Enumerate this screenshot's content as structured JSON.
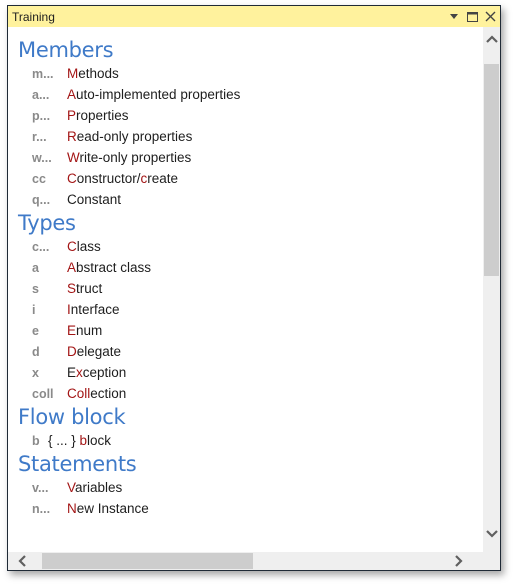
{
  "window": {
    "title": "Training",
    "controls": {
      "dropdown": "dropdown-icon",
      "maximize": "maximize-icon",
      "close": "close-icon"
    }
  },
  "sections": [
    {
      "heading": "Members",
      "items": [
        {
          "abbr": "m...",
          "parts": [
            {
              "t": "M",
              "h": true
            },
            {
              "t": "ethods",
              "h": false
            }
          ]
        },
        {
          "abbr": "a...",
          "parts": [
            {
              "t": "A",
              "h": true
            },
            {
              "t": "uto-implemented properties",
              "h": false
            }
          ]
        },
        {
          "abbr": "p...",
          "parts": [
            {
              "t": "P",
              "h": true
            },
            {
              "t": "roperties",
              "h": false
            }
          ]
        },
        {
          "abbr": "r...",
          "parts": [
            {
              "t": "R",
              "h": true
            },
            {
              "t": "ead-only properties",
              "h": false
            }
          ]
        },
        {
          "abbr": "w...",
          "parts": [
            {
              "t": "W",
              "h": true
            },
            {
              "t": "rite-only properties",
              "h": false
            }
          ]
        },
        {
          "abbr": "cc",
          "parts": [
            {
              "t": "C",
              "h": true
            },
            {
              "t": "onstructor/",
              "h": false
            },
            {
              "t": "c",
              "h": true
            },
            {
              "t": "reate",
              "h": false
            }
          ]
        },
        {
          "abbr": "q...",
          "parts": [
            {
              "t": "Constant",
              "h": false
            }
          ]
        }
      ]
    },
    {
      "heading": "Types",
      "items": [
        {
          "abbr": "c...",
          "parts": [
            {
              "t": "C",
              "h": true
            },
            {
              "t": "lass",
              "h": false
            }
          ]
        },
        {
          "abbr": "a",
          "parts": [
            {
              "t": "A",
              "h": true
            },
            {
              "t": "bstract class",
              "h": false
            }
          ]
        },
        {
          "abbr": "s",
          "parts": [
            {
              "t": "S",
              "h": true
            },
            {
              "t": "truct",
              "h": false
            }
          ]
        },
        {
          "abbr": "i",
          "parts": [
            {
              "t": "I",
              "h": true
            },
            {
              "t": "nterface",
              "h": false
            }
          ]
        },
        {
          "abbr": "e",
          "parts": [
            {
              "t": "E",
              "h": true
            },
            {
              "t": "num",
              "h": false
            }
          ]
        },
        {
          "abbr": "d",
          "parts": [
            {
              "t": "D",
              "h": true
            },
            {
              "t": "elegate",
              "h": false
            }
          ]
        },
        {
          "abbr": "x",
          "parts": [
            {
              "t": "E",
              "h": false
            },
            {
              "t": "x",
              "h": true
            },
            {
              "t": "ception",
              "h": false
            }
          ]
        },
        {
          "abbr": "coll",
          "parts": [
            {
              "t": "Coll",
              "h": true
            },
            {
              "t": "ection",
              "h": false
            }
          ]
        }
      ]
    },
    {
      "heading": "Flow block",
      "flow": true,
      "items": [
        {
          "abbr": "b",
          "parts": [
            {
              "t": "{ ... } ",
              "h": false
            },
            {
              "t": "b",
              "h": true
            },
            {
              "t": "lock",
              "h": false
            }
          ]
        }
      ]
    },
    {
      "heading": "Statements",
      "items": [
        {
          "abbr": "v...",
          "parts": [
            {
              "t": "V",
              "h": true
            },
            {
              "t": "ariables",
              "h": false
            }
          ]
        },
        {
          "abbr": "n...",
          "parts": [
            {
              "t": "N",
              "h": true
            },
            {
              "t": "ew Instance",
              "h": false
            }
          ]
        }
      ]
    }
  ],
  "scrollbars": {
    "vertical": {
      "up_icon": "chevron-up-icon",
      "down_icon": "chevron-down-icon",
      "position_fraction": 0.0,
      "visible_fraction": 0.44
    },
    "horizontal": {
      "left_icon": "chevron-left-icon",
      "right_icon": "chevron-right-icon",
      "position_fraction": 0.0,
      "visible_fraction": 0.5
    }
  },
  "colors": {
    "titlebar": "#fff29d",
    "heading": "#3f7ac8",
    "abbr": "#8a8a8a",
    "highlight": "#a31515",
    "text": "#1e1e1e"
  }
}
